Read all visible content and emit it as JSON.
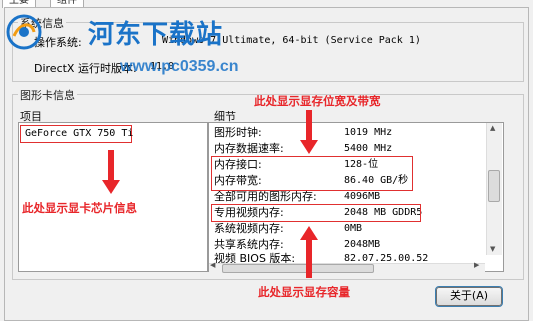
{
  "tabs": [
    "主要",
    "组件"
  ],
  "watermark": {
    "title": "河东下载站",
    "url": "www.pc0359.cn"
  },
  "system_info": {
    "group_label": "系统信息",
    "os_label": "操作系统:",
    "os_value": "Windows 7 Ultimate, 64-bit (Service Pack 1)",
    "directx_label": "DirectX 运行时版本:",
    "directx_value": "11.0"
  },
  "graphics": {
    "group_label": "图形卡信息",
    "col_item": "项目",
    "col_detail": "细节",
    "selected_item": "GeForce GTX 750 Ti",
    "details": [
      {
        "label": "图形时钟:",
        "value": "1019 MHz"
      },
      {
        "label": "内存数据速率:",
        "value": "5400 MHz"
      },
      {
        "label": "内存接口:",
        "value": "128-位"
      },
      {
        "label": "内存带宽:",
        "value": "86.40 GB/秒"
      },
      {
        "label": "全部可用的图形内存:",
        "value": "4096MB"
      },
      {
        "label": "专用视频内存:",
        "value": "2048 MB GDDR5"
      },
      {
        "label": "系统视频内存:",
        "value": "0MB"
      },
      {
        "label": "共享系统内存:",
        "value": "2048MB"
      },
      {
        "label": "视频 BIOS 版本:",
        "value": "82.07.25.00.52"
      }
    ]
  },
  "annotations": {
    "top": "此处显示显存位宽及带宽",
    "left": "此处显示显卡芯片信息",
    "bottom": "此处显示显存容量"
  },
  "about_button": "关于(A)",
  "colors": {
    "annotation_red": "#e8262a",
    "watermark_blue": "#1a73c8"
  }
}
